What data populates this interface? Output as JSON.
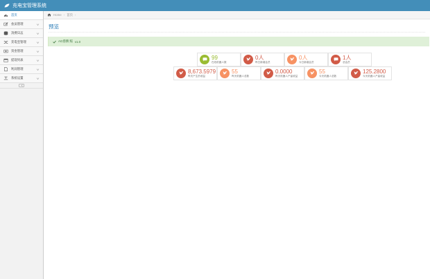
{
  "app": {
    "title": "充电宝管理系统"
  },
  "sidebar": {
    "items": [
      {
        "label": "首页",
        "icon": "tachometer-icon"
      },
      {
        "label": "会员管理",
        "icon": "edit-icon"
      },
      {
        "label": "消费日志",
        "icon": "database-icon"
      },
      {
        "label": "充电宝管理",
        "icon": "random-icon"
      },
      {
        "label": "资金管理",
        "icon": "money-icon"
      },
      {
        "label": "提现列表",
        "icon": "calendar-icon"
      },
      {
        "label": "利润管理",
        "icon": "file-icon"
      },
      {
        "label": "系统设置",
        "icon": "text-width-icon"
      }
    ],
    "active_index": 0
  },
  "breadcrumb": {
    "home": "Home",
    "current": "首页"
  },
  "page": {
    "title": "预览"
  },
  "alert": {
    "text": "AG捞牌 照",
    "version": "v1.0"
  },
  "stats_row1": [
    {
      "value": "99",
      "label": "在线机器人数",
      "color": "#9abc32"
    },
    {
      "value": "0人",
      "label": "昨日新增会员",
      "color": "#d15b47"
    },
    {
      "value": "0人",
      "label": "今日新增会员",
      "color": "#f79263"
    },
    {
      "value": "1人",
      "label": "总会员",
      "color": "#d15b47"
    }
  ],
  "stats_row2": [
    {
      "value": "8,673.5979",
      "label": "昨天产生的收益",
      "color": "#d15b47"
    },
    {
      "value": "55",
      "label": "昨天机器人总数",
      "color": "#f79263"
    },
    {
      "value": "0.0000",
      "label": "昨天机器人产量收益",
      "color": "#d15b47"
    },
    {
      "value": "55",
      "label": "今天机器人总数",
      "color": "#f79263"
    },
    {
      "value": "125.2800",
      "label": "今天机器人产量收益",
      "color": "#d15b47"
    }
  ],
  "colors": {
    "navbar": "#438eb9",
    "accent": "#2679b5",
    "success_bg": "#dff0d8"
  }
}
